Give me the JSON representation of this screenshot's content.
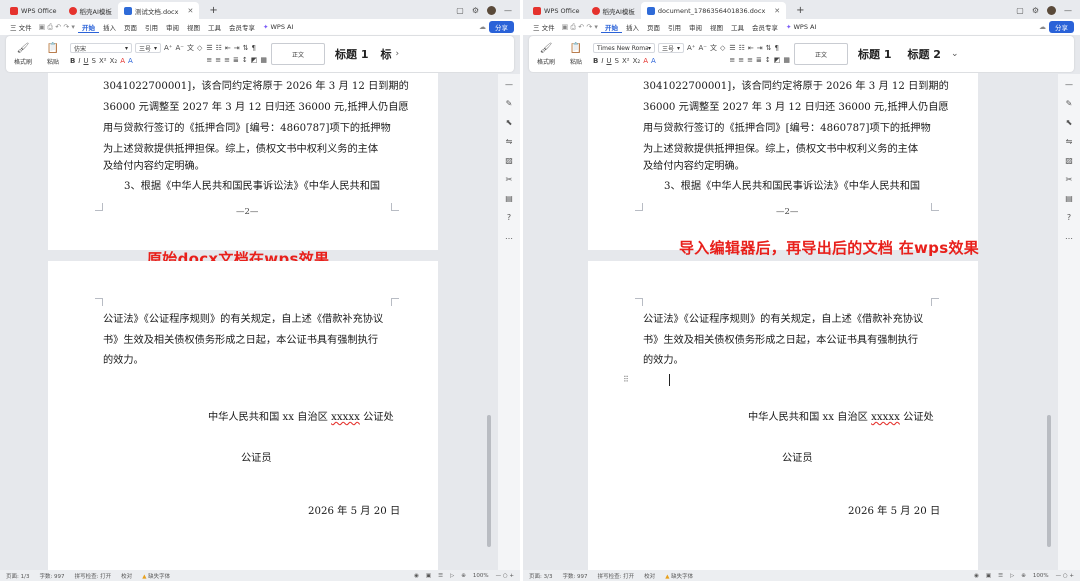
{
  "left": {
    "tabs": [
      {
        "label": "WPS Office",
        "icon": "wps-logo-icon"
      },
      {
        "label": "稻壳AI模板",
        "icon": "docer-icon"
      },
      {
        "label": "测试文档.docx",
        "icon": "doc-file-icon"
      }
    ],
    "menus": [
      "三 文件",
      "开始",
      "插入",
      "页面",
      "引用",
      "审阅",
      "视图",
      "工具",
      "会员专享"
    ],
    "active_menu": "开始",
    "wps_ai": "WPS AI",
    "share": "分享",
    "ribbon": {
      "format_painter": "格式刷",
      "paste": "粘贴",
      "font_name": "仿宋",
      "font_size": "三号",
      "style_normal": "正文",
      "heading1": "标题 1",
      "heading2": "标"
    },
    "page1_lines": [
      "3041022700001]，该合同约定将原于 2026 年 3 月 12 日到期的",
      "36000 元调整至 2027 年 3 月 12 日归还 36000 元,抵押人仍自愿",
      "用与贷款行签订的《抵押合同》[编号：4860787]项下的抵押物",
      "为上述贷款提供抵押担保。综上，债权文书中权利义务的主体",
      "及给付内容约定明确。"
    ],
    "page1_item3": "3、根据《中华人民共和国民事诉讼法》《中华人民共和国",
    "page_number": "—2—",
    "annotation": "原始docx文档在wps效果",
    "page2_lines": [
      "公证法》《公证程序规则》的有关规定，自上述《借款补充协议",
      "书》生效及相关债权债务形成之日起，本公证书具有强制执行",
      "的效力。"
    ],
    "office_prefix": "中华人民共和国 xx 自治区",
    "office_x": "xxxxx",
    "office_suffix": "公证处",
    "notary": "公证员",
    "date": "2026 年 5 月 20 日",
    "status": {
      "page": "页面: 1/3",
      "words": "字数: 997",
      "spell": "拼写检查: 打开",
      "proof": "校对",
      "missing_font": "缺失字体",
      "zoom": "100%"
    }
  },
  "right": {
    "tabs": [
      {
        "label": "WPS Office",
        "icon": "wps-logo-icon"
      },
      {
        "label": "稻壳AI模板",
        "icon": "docer-icon"
      },
      {
        "label": "document_1786356401836.docx",
        "icon": "doc-file-icon"
      }
    ],
    "menus": [
      "三 文件",
      "开始",
      "插入",
      "页面",
      "引用",
      "审阅",
      "视图",
      "工具",
      "会员专享"
    ],
    "active_menu": "开始",
    "wps_ai": "WPS AI",
    "share": "分享",
    "ribbon": {
      "format_painter": "格式刷",
      "paste": "粘贴",
      "font_name": "Times New Roman",
      "font_size": "三号",
      "style_normal": "正文",
      "heading1": "标题 1",
      "heading2": "标题 2"
    },
    "page1_lines": [
      "3041022700001]，该合同约定将原于 2026 年 3 月 12 日到期的",
      "36000 元调整至 2027 年 3 月 12 日归还 36000 元,抵押人仍自愿",
      "用与贷款行签订的《抵押合同》[编号：4860787]项下的抵押物",
      "为上述贷款提供抵押担保。综上，债权文书中权利义务的主体",
      "及给付内容约定明确。"
    ],
    "page1_item3": "3、根据《中华人民共和国民事诉讼法》《中华人民共和国",
    "page_number": "—2—",
    "annotation": "导入编辑器后，再导出后的文档 在wps效果",
    "page2_lines": [
      "公证法》《公证程序规则》的有关规定，自上述《借款补充协议",
      "书》生效及相关债权债务形成之日起，本公证书具有强制执行",
      "的效力。"
    ],
    "office_prefix": "中华人民共和国 xx 自治区",
    "office_x": "xxxxx",
    "office_suffix": "公证处",
    "notary": "公证员",
    "date": "2026 年 5 月 20 日",
    "status": {
      "page": "页面: 3/3",
      "words": "字数: 997",
      "spell": "拼写检查: 打开",
      "proof": "校对",
      "missing_font": "缺失字体",
      "zoom": "100%"
    }
  },
  "colors": {
    "accent": "#2a62d8",
    "annotation_red": "#e8201b",
    "wps_red": "#e5322d"
  }
}
